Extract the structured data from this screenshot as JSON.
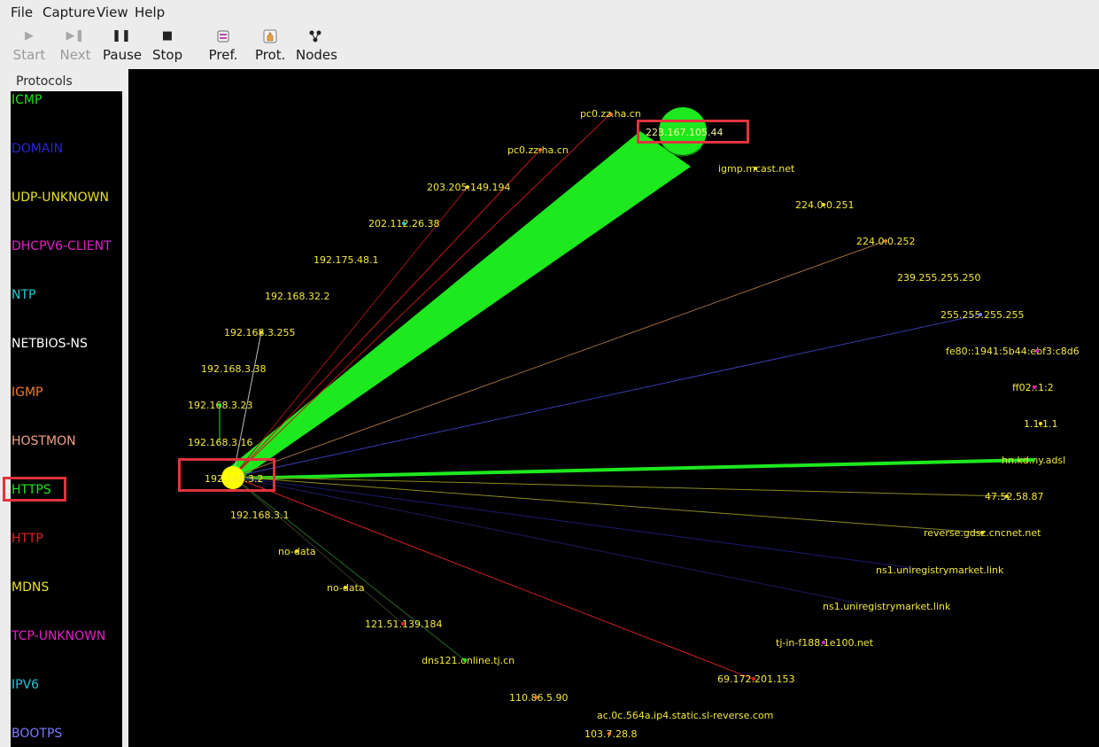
{
  "menu": {
    "file": "File",
    "capture": "Capture",
    "view": "View",
    "help": "Help"
  },
  "toolbar": {
    "start": "Start",
    "next": "Next",
    "pause": "Pause",
    "stop": "Stop",
    "pref": "Pref.",
    "prot": "Prot.",
    "nodes": "Nodes"
  },
  "protocols": {
    "title": "Protocols",
    "items": [
      {
        "label": "ICMP",
        "color": "#21e021"
      },
      {
        "label": "DOMAIN",
        "color": "#2626d8"
      },
      {
        "label": "UDP-UNKNOWN",
        "color": "#e8e020"
      },
      {
        "label": "DHCPV6-CLIENT",
        "color": "#e020c8"
      },
      {
        "label": "NTP",
        "color": "#20c8d8"
      },
      {
        "label": "NETBIOS-NS",
        "color": "#ffffff"
      },
      {
        "label": "IGMP",
        "color": "#f07a2a"
      },
      {
        "label": "HOSTMON",
        "color": "#f0a080"
      },
      {
        "label": "HTTPS",
        "color": "#21e021"
      },
      {
        "label": "HTTP",
        "color": "#e02020"
      },
      {
        "label": "MDNS",
        "color": "#e8e020"
      },
      {
        "label": "TCP-UNKNOWN",
        "color": "#e020c8"
      },
      {
        "label": "IPV6",
        "color": "#20c8d8"
      },
      {
        "label": "BOOTPS",
        "color": "#7a7aff"
      }
    ]
  },
  "nodes": {
    "pc0_1": "pc0.zz.ha.cn",
    "n223": "223.167.105.44",
    "pc0_2": "pc0.zz.ha.cn",
    "igmp": "igmp.mcast.net",
    "n203": "203.205.149.194",
    "n224_251": "224.0.0.251",
    "n202": "202.112.26.38",
    "n224_252": "224.0.0.252",
    "n192_175": "192.175.48.1",
    "n239": "239.255.255.250",
    "n192_168_32": "192.168.32.2",
    "n255": "255.255.255.255",
    "n192_3_255": "192.168.3.255",
    "fe80": "fe80::1941:5b44:ebf3:c8d6",
    "n192_3_38": "192.168.3.38",
    "ff02": "ff02::1:2",
    "n192_3_23": "192.168.3.23",
    "n1111": "1.1.1.1",
    "n192_3_16": "192.168.3.16",
    "hn": "hn.kd.ny.adsl",
    "self": "192.168.3.2",
    "n47": "47.52.58.87",
    "n192_3_1": "192.168.3.1",
    "reverse": "reverse.gdsz.cncnet.net",
    "nodata1": "no-data",
    "ns1a": "ns1.uniregistrymarket.link",
    "nodata2": "no-data",
    "ns1b": "ns1.uniregistrymarket.link",
    "n121": "121.51.139.184",
    "tj": "tj-in-f188.1e100.net",
    "dns121": "dns121.online.tj.cn",
    "n69": "69.172.201.153",
    "n110": "110.86.5.90",
    "ac": "ac.0c.564a.ip4.static.sl-reverse.com",
    "n103": "103.7.28.8"
  }
}
